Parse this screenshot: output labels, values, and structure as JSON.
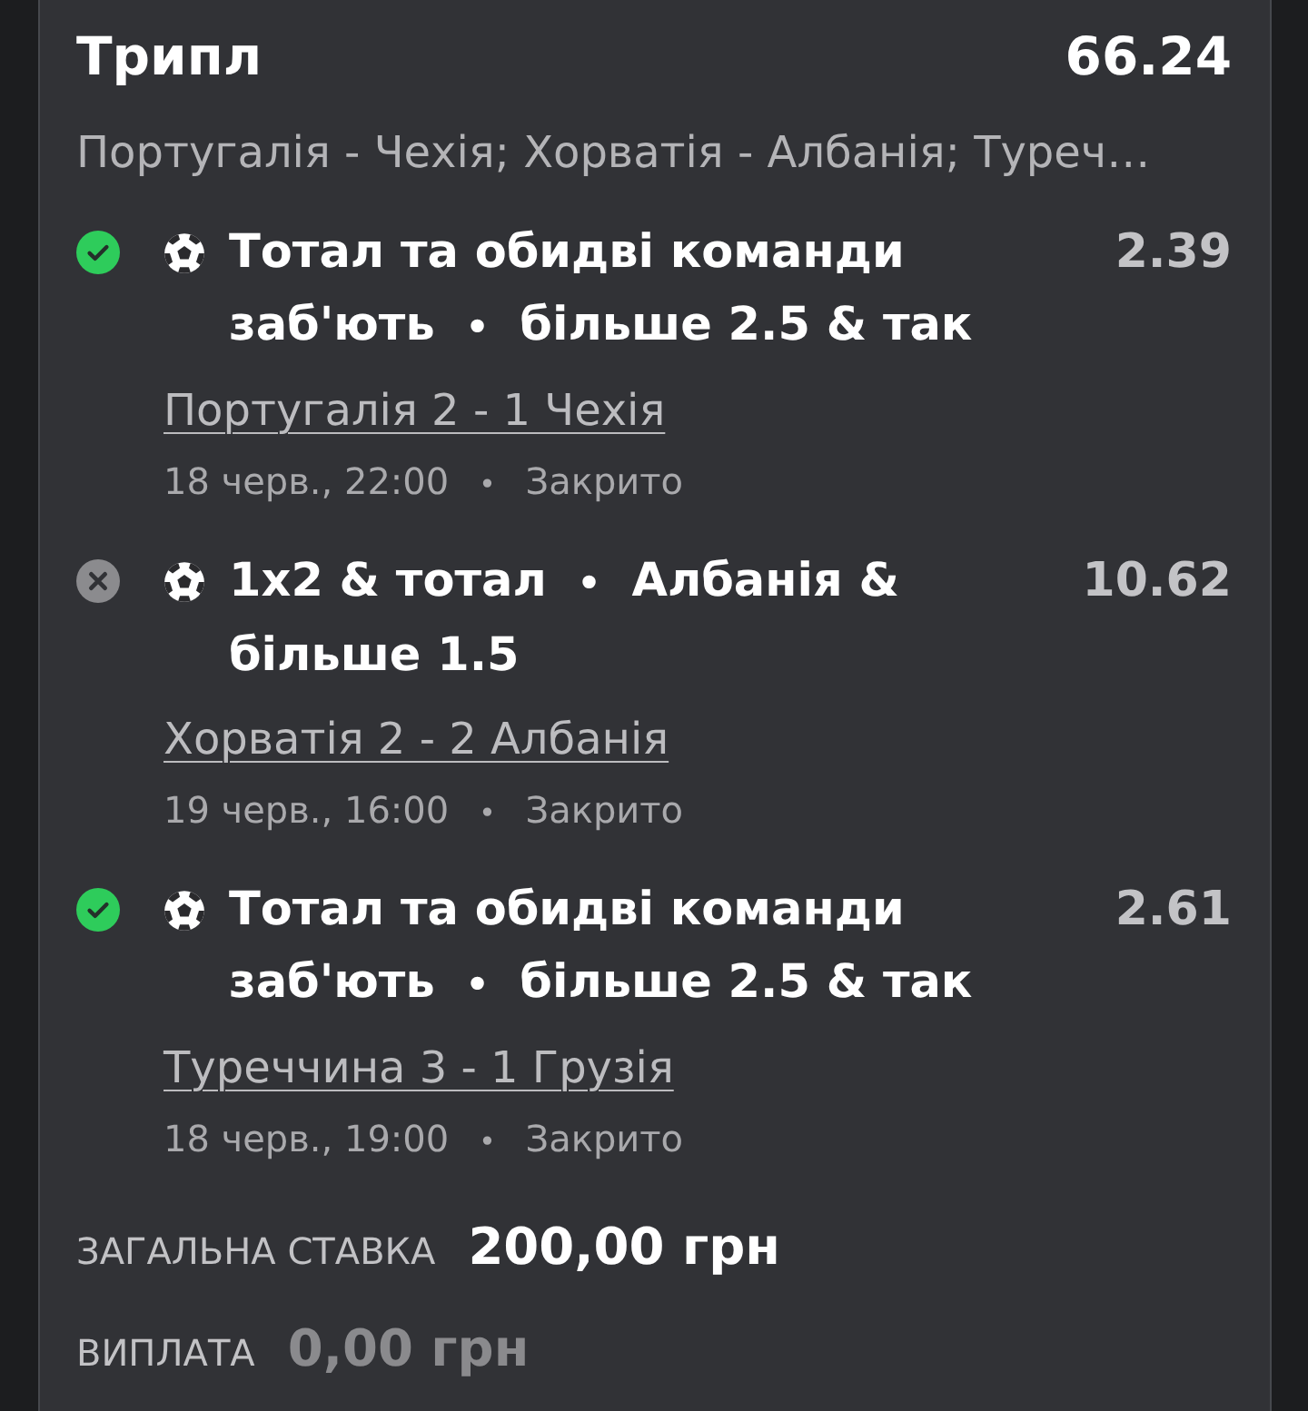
{
  "bet": {
    "type": "Трипл",
    "odds": "66.24",
    "events_summary": "Португалія - Чехія; Хорватія - Албанія; Туреч…"
  },
  "selections": [
    {
      "won": true,
      "market": "Тотал та обидві команди заб'ють",
      "separator": "•",
      "pick": "більше 2.5 & так",
      "odds": "2.39",
      "match": "Португалія 2 - 1 Чехія",
      "time": "18 черв., 22:00",
      "meta_separator": "•",
      "state": "Закрито"
    },
    {
      "won": false,
      "market": "1x2 & тотал",
      "separator": "•",
      "pick": "Албанія & більше 1.5",
      "odds": "10.62",
      "match": "Хорватія 2 - 2 Албанія",
      "time": "19 черв., 16:00",
      "meta_separator": "•",
      "state": "Закрито"
    },
    {
      "won": true,
      "market": "Тотал та обидві команди заб'ють",
      "separator": "•",
      "pick": "більше 2.5 & так",
      "odds": "2.61",
      "match": "Туреччина 3 - 1 Грузія",
      "time": "18 черв., 19:00",
      "meta_separator": "•",
      "state": "Закрито"
    }
  ],
  "summary": [
    {
      "kind": "stake",
      "label": "ЗАГАЛЬНА СТАВКА",
      "value": "200,00 грн"
    },
    {
      "kind": "payout",
      "label": "ВИПЛАТА",
      "value": "0,00 грн"
    }
  ]
}
